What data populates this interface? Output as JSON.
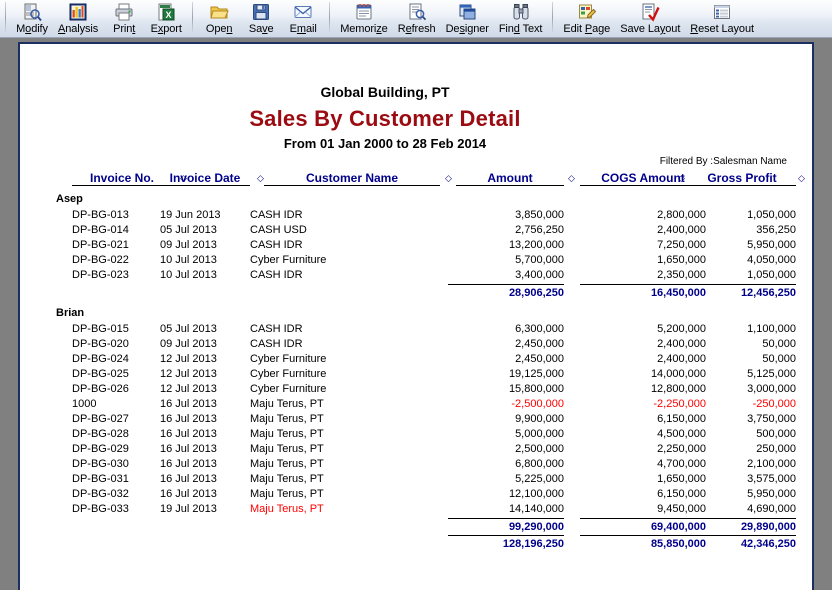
{
  "toolbar": {
    "groups": [
      {
        "buttons": [
          {
            "label": "Modify",
            "accel": "o",
            "icon": "modify-magnify-icon",
            "name": "toolbar-button-modify"
          },
          {
            "label": "Analysis",
            "accel": "A",
            "icon": "analysis-chart-icon",
            "name": "toolbar-button-analysis"
          },
          {
            "label": "Print",
            "accel": "t",
            "icon": "printer-icon",
            "name": "toolbar-button-print"
          },
          {
            "label": "Export",
            "accel": "x",
            "icon": "export-excel-icon",
            "name": "toolbar-button-export"
          }
        ]
      },
      {
        "buttons": [
          {
            "label": "Open",
            "accel": "n",
            "icon": "folder-open-icon",
            "name": "toolbar-button-open"
          },
          {
            "label": "Save",
            "accel": "v",
            "icon": "floppy-disk-icon",
            "name": "toolbar-button-save"
          },
          {
            "label": "Email",
            "accel": "m",
            "icon": "envelope-icon",
            "name": "toolbar-button-email"
          }
        ]
      },
      {
        "buttons": [
          {
            "label": "Memorize",
            "accel": "z",
            "icon": "notebook-icon",
            "name": "toolbar-button-memorize"
          },
          {
            "label": "Refresh",
            "accel": "e",
            "icon": "refresh-page-icon",
            "name": "toolbar-button-refresh"
          },
          {
            "label": "Designer",
            "accel": "s",
            "icon": "designer-window-icon",
            "name": "toolbar-button-designer"
          },
          {
            "label": "Find Text",
            "accel": "d",
            "icon": "binoculars-icon",
            "name": "toolbar-button-find-text"
          }
        ]
      },
      {
        "buttons": [
          {
            "label": "Edit Page",
            "accel": "P",
            "icon": "edit-page-pencil-icon",
            "name": "toolbar-button-edit-page"
          },
          {
            "label": "Save Layout",
            "accel": "y",
            "icon": "save-layout-check-icon",
            "name": "toolbar-button-save-layout"
          },
          {
            "label": "Reset Layout",
            "accel": "R",
            "icon": "reset-layout-list-icon",
            "name": "toolbar-button-reset-layout"
          }
        ]
      }
    ]
  },
  "report": {
    "company": "Global Building, PT",
    "title": "Sales By Customer Detail",
    "date_range": "From 01 Jan 2000 to 28 Feb 2014",
    "filter_text": "Filtered By :Salesman Name",
    "columns": [
      {
        "label": "Invoice No.",
        "name": "column-header-invoice-no"
      },
      {
        "label": "Invoice Date",
        "name": "column-header-invoice-date"
      },
      {
        "label": "Customer Name",
        "name": "column-header-customer-name"
      },
      {
        "label": "Amount",
        "name": "column-header-amount"
      },
      {
        "label": "COGS Amount",
        "name": "column-header-cogs-amount"
      },
      {
        "label": "Gross Profit",
        "name": "column-header-gross-profit"
      }
    ],
    "groups": [
      {
        "name": "Asep",
        "rows": [
          {
            "invoice": "DP-BG-013",
            "date": "19 Jun 2013",
            "customer": "CASH IDR",
            "amount": "3,850,000",
            "cogs": "2,800,000",
            "gross": "1,050,000",
            "negative": false,
            "customer_red": false
          },
          {
            "invoice": "DP-BG-014",
            "date": "05 Jul 2013",
            "customer": "CASH USD",
            "amount": "2,756,250",
            "cogs": "2,400,000",
            "gross": "356,250",
            "negative": false,
            "customer_red": false
          },
          {
            "invoice": "DP-BG-021",
            "date": "09 Jul 2013",
            "customer": "CASH IDR",
            "amount": "13,200,000",
            "cogs": "7,250,000",
            "gross": "5,950,000",
            "negative": false,
            "customer_red": false
          },
          {
            "invoice": "DP-BG-022",
            "date": "10 Jul 2013",
            "customer": "Cyber Furniture",
            "amount": "5,700,000",
            "cogs": "1,650,000",
            "gross": "4,050,000",
            "negative": false,
            "customer_red": false
          },
          {
            "invoice": "DP-BG-023",
            "date": "10 Jul 2013",
            "customer": "CASH IDR",
            "amount": "3,400,000",
            "cogs": "2,350,000",
            "gross": "1,050,000",
            "negative": false,
            "customer_red": false
          }
        ],
        "subtotal": {
          "amount": "28,906,250",
          "cogs": "16,450,000",
          "gross": "12,456,250"
        }
      },
      {
        "name": "Brian",
        "rows": [
          {
            "invoice": "DP-BG-015",
            "date": "05 Jul 2013",
            "customer": "CASH IDR",
            "amount": "6,300,000",
            "cogs": "5,200,000",
            "gross": "1,100,000",
            "negative": false,
            "customer_red": false
          },
          {
            "invoice": "DP-BG-020",
            "date": "09 Jul 2013",
            "customer": "CASH IDR",
            "amount": "2,450,000",
            "cogs": "2,400,000",
            "gross": "50,000",
            "negative": false,
            "customer_red": false
          },
          {
            "invoice": "DP-BG-024",
            "date": "12 Jul 2013",
            "customer": "Cyber Furniture",
            "amount": "2,450,000",
            "cogs": "2,400,000",
            "gross": "50,000",
            "negative": false,
            "customer_red": false
          },
          {
            "invoice": "DP-BG-025",
            "date": "12 Jul 2013",
            "customer": "Cyber Furniture",
            "amount": "19,125,000",
            "cogs": "14,000,000",
            "gross": "5,125,000",
            "negative": false,
            "customer_red": false
          },
          {
            "invoice": "DP-BG-026",
            "date": "12 Jul 2013",
            "customer": "Cyber Furniture",
            "amount": "15,800,000",
            "cogs": "12,800,000",
            "gross": "3,000,000",
            "negative": false,
            "customer_red": false
          },
          {
            "invoice": "1000",
            "date": "16 Jul 2013",
            "customer": "Maju Terus, PT",
            "amount": "-2,500,000",
            "cogs": "-2,250,000",
            "gross": "-250,000",
            "negative": true,
            "customer_red": false
          },
          {
            "invoice": "DP-BG-027",
            "date": "16 Jul 2013",
            "customer": "Maju Terus, PT",
            "amount": "9,900,000",
            "cogs": "6,150,000",
            "gross": "3,750,000",
            "negative": false,
            "customer_red": false
          },
          {
            "invoice": "DP-BG-028",
            "date": "16 Jul 2013",
            "customer": "Maju Terus, PT",
            "amount": "5,000,000",
            "cogs": "4,500,000",
            "gross": "500,000",
            "negative": false,
            "customer_red": false
          },
          {
            "invoice": "DP-BG-029",
            "date": "16 Jul 2013",
            "customer": "Maju Terus, PT",
            "amount": "2,500,000",
            "cogs": "2,250,000",
            "gross": "250,000",
            "negative": false,
            "customer_red": false
          },
          {
            "invoice": "DP-BG-030",
            "date": "16 Jul 2013",
            "customer": "Maju Terus, PT",
            "amount": "6,800,000",
            "cogs": "4,700,000",
            "gross": "2,100,000",
            "negative": false,
            "customer_red": false
          },
          {
            "invoice": "DP-BG-031",
            "date": "16 Jul 2013",
            "customer": "Maju Terus, PT",
            "amount": "5,225,000",
            "cogs": "1,650,000",
            "gross": "3,575,000",
            "negative": false,
            "customer_red": false
          },
          {
            "invoice": "DP-BG-032",
            "date": "16 Jul 2013",
            "customer": "Maju Terus, PT",
            "amount": "12,100,000",
            "cogs": "6,150,000",
            "gross": "5,950,000",
            "negative": false,
            "customer_red": false
          },
          {
            "invoice": "DP-BG-033",
            "date": "19 Jul 2013",
            "customer": "Maju Terus, PT",
            "amount": "14,140,000",
            "cogs": "9,450,000",
            "gross": "4,690,000",
            "negative": false,
            "customer_red": true
          }
        ],
        "subtotal": {
          "amount": "99,290,000",
          "cogs": "69,400,000",
          "gross": "29,890,000"
        }
      }
    ],
    "grand_total": {
      "amount": "128,196,250",
      "cogs": "85,850,000",
      "gross": "42,346,250"
    },
    "colors": {
      "title": "#9b0b12",
      "header_blue": "#00008b",
      "total_blue": "#00008b",
      "negative_red": "#ff0000",
      "page_border": "#1b2f63",
      "workspace": "#808080"
    }
  }
}
